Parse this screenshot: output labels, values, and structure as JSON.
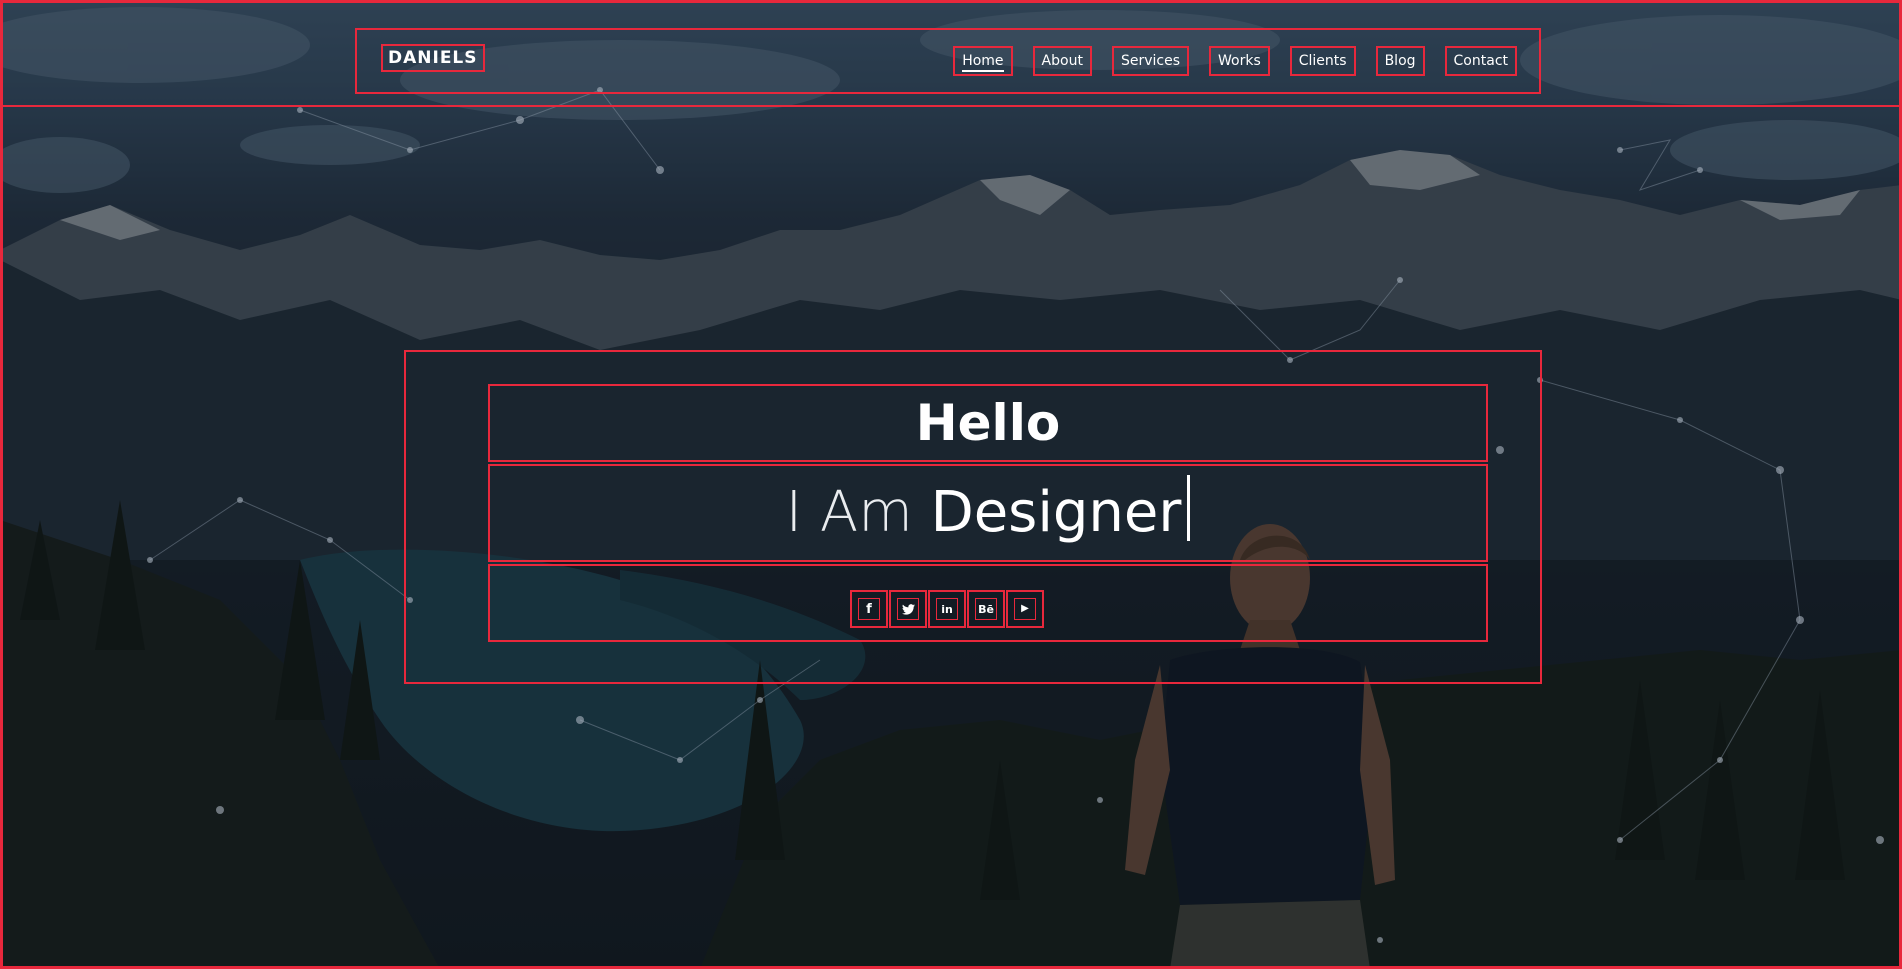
{
  "header": {
    "logo": "DANIELS",
    "nav": [
      {
        "label": "Home",
        "active": true
      },
      {
        "label": "About",
        "active": false
      },
      {
        "label": "Services",
        "active": false
      },
      {
        "label": "Works",
        "active": false
      },
      {
        "label": "Clients",
        "active": false
      },
      {
        "label": "Blog",
        "active": false
      },
      {
        "label": "Contact",
        "active": false
      }
    ]
  },
  "hero": {
    "greeting": "Hello",
    "tagline_prefix": "I Am",
    "tagline_role": "Designer"
  },
  "social": [
    {
      "icon": "facebook-icon",
      "glyph": "f"
    },
    {
      "icon": "twitter-icon",
      "glyph": "🐦"
    },
    {
      "icon": "linkedin-icon",
      "glyph": "in"
    },
    {
      "icon": "behance-icon",
      "glyph": "Bē"
    },
    {
      "icon": "youtube-icon",
      "glyph": "▶"
    }
  ],
  "colors": {
    "accent_outline": "#e8283c",
    "text": "#ffffff",
    "overlay": "#131b22"
  }
}
